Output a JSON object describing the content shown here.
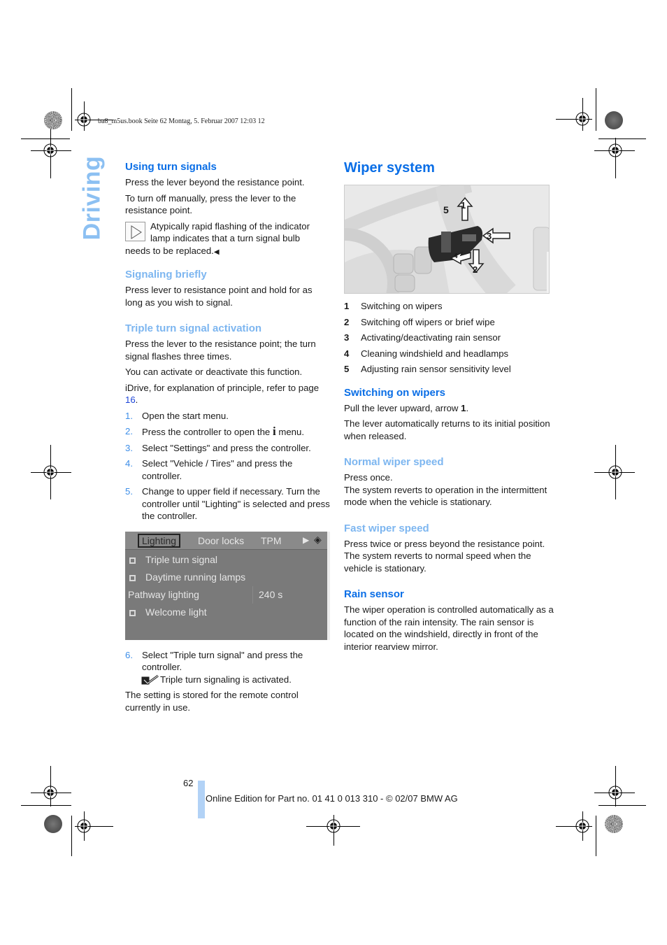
{
  "print_header": "ba8_m5us.book  Seite 62  Montag, 5. Februar 2007  12:03 12",
  "side_tab": "Driving",
  "left": {
    "using_turn_signals": {
      "heading": "Using turn signals",
      "p1": "Press the lever beyond the resistance point.",
      "p2": "To turn off manually, press the lever to the resistance point.",
      "note_icon": "triangle-note-icon",
      "note_first": "Atypically rapid flashing of the indicator lamp indicates that a turn signal bulb",
      "note_rest": "needs to be replaced.",
      "note_end": "◀"
    },
    "signaling_briefly": {
      "heading": "Signaling briefly",
      "p1": "Press lever to resistance point and hold for as long as you wish to signal."
    },
    "triple_turn": {
      "heading": "Triple turn signal activation",
      "p1": "Press the lever to the resistance point; the turn signal flashes three times.",
      "p2": "You can activate or deactivate this function.",
      "p3_pre": "iDrive, for explanation of principle, refer to page ",
      "p3_link": "16",
      "p3_post": ".",
      "steps": [
        {
          "num": "1.",
          "text": "Open the start menu."
        },
        {
          "num": "2.",
          "text_pre": "Press the controller to open the ",
          "icon": "i",
          "text_post": " menu."
        },
        {
          "num": "3.",
          "text": "Select \"Settings\" and press the controller."
        },
        {
          "num": "4.",
          "text": "Select \"Vehicle / Tires\" and press the controller."
        },
        {
          "num": "5.",
          "text": "Change to upper field if necessary. Turn the controller until \"Lighting\" is selected and press the controller."
        }
      ],
      "screen": {
        "tabs": [
          "Lighting",
          "Door locks",
          "TPM"
        ],
        "rows": [
          {
            "label": "Triple turn signal",
            "checkbox": true
          },
          {
            "label": "Daytime running lamps",
            "checkbox": true
          },
          {
            "label": "Pathway lighting",
            "value": "240 s"
          },
          {
            "label": "Welcome light",
            "checkbox": true
          }
        ]
      },
      "step6": {
        "num": "6.",
        "text": "Select \"Triple turn signal\" and press the controller."
      },
      "activated": "Triple turn signaling is activated.",
      "stored": "The setting is stored for the remote control currently in use."
    }
  },
  "right": {
    "title": "Wiper system",
    "figure_callouts": [
      "1",
      "2",
      "3",
      "4",
      "5"
    ],
    "legend": [
      {
        "n": "1",
        "text": "Switching on wipers"
      },
      {
        "n": "2",
        "text": "Switching off wipers or brief wipe"
      },
      {
        "n": "3",
        "text": "Activating/deactivating rain sensor"
      },
      {
        "n": "4",
        "text": "Cleaning windshield and headlamps"
      },
      {
        "n": "5",
        "text": "Adjusting rain sensor sensitivity level"
      }
    ],
    "switching_on": {
      "heading": "Switching on wipers",
      "p1_pre": "Pull the lever upward, arrow ",
      "p1_bold": "1",
      "p1_post": ".",
      "p2": "The lever automatically returns to its initial position when released."
    },
    "normal_speed": {
      "heading": "Normal wiper speed",
      "p1": "Press once.",
      "p2": "The system reverts to operation in the intermittent mode when the vehicle is stationary."
    },
    "fast_speed": {
      "heading": "Fast wiper speed",
      "p1": "Press twice or press beyond the resistance point.",
      "p2": "The system reverts to normal speed when the vehicle is stationary."
    },
    "rain_sensor": {
      "heading": "Rain sensor",
      "p1": "The wiper operation is controlled automatically as a function of the rain intensity. The rain sensor is located on the windshield, directly in front of the interior rearview mirror."
    }
  },
  "footer": {
    "page_number": "62",
    "edition": "Online Edition for Part no. 01 41 0 013 310 - © 02/07 BMW AG"
  },
  "colors": {
    "heading_blue": "#0a6ee6",
    "subheading_light_blue": "#7db6f0",
    "side_tab": "#8cc0f2",
    "footer_bar": "#b2d2f6"
  }
}
